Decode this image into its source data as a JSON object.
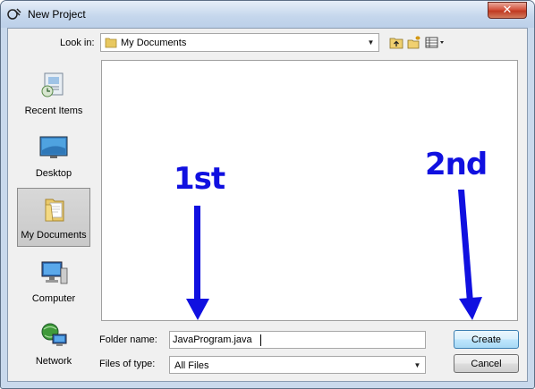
{
  "window": {
    "title": "New Project"
  },
  "look_in": {
    "label": "Look in:",
    "value": "My Documents"
  },
  "sidebar": {
    "items": [
      {
        "label": "Recent Items",
        "icon": "recent-items-icon"
      },
      {
        "label": "Desktop",
        "icon": "desktop-icon"
      },
      {
        "label": "My Documents",
        "icon": "my-documents-icon",
        "selected": true
      },
      {
        "label": "Computer",
        "icon": "computer-icon"
      },
      {
        "label": "Network",
        "icon": "network-icon"
      }
    ]
  },
  "toolbar": {
    "icons": [
      "up-folder-icon",
      "new-folder-icon",
      "view-menu-icon"
    ]
  },
  "annotations": {
    "first": "1st",
    "second": "2nd",
    "color": "#1010e0"
  },
  "folder_name": {
    "label": "Folder name:",
    "value": "JavaProgram.java"
  },
  "files_of_type": {
    "label": "Files of type:",
    "value": "All Files"
  },
  "buttons": {
    "create": "Create",
    "cancel": "Cancel"
  }
}
